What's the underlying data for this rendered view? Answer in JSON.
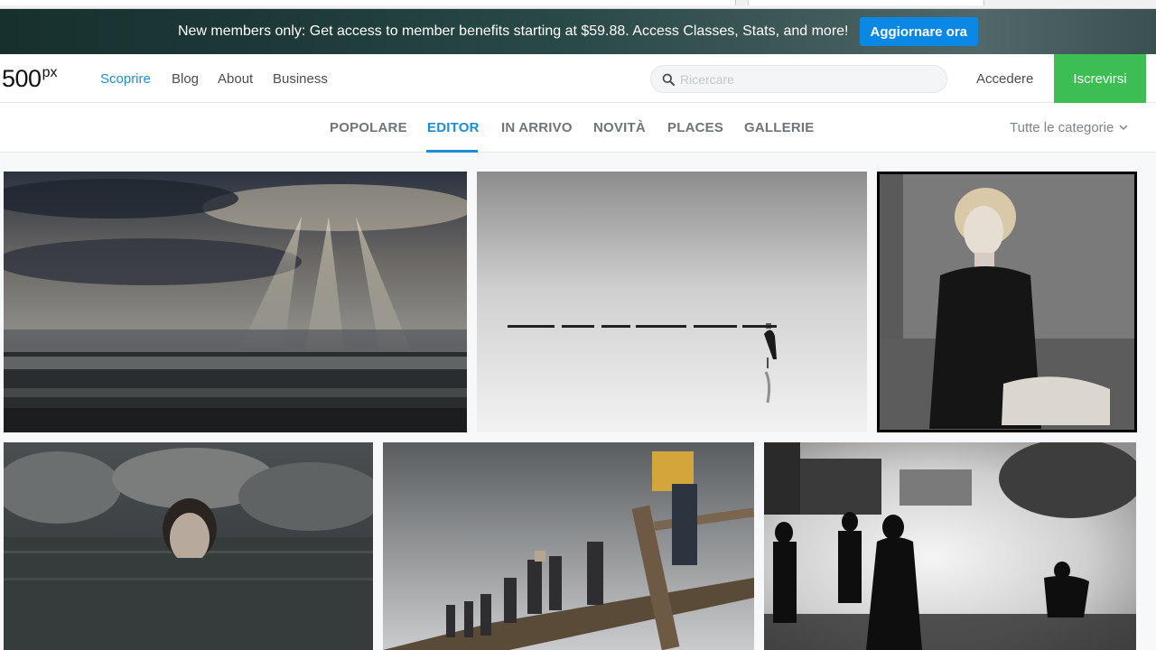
{
  "promo": {
    "text": "New members only: Get access to member benefits starting at $59.88. Access Classes, Stats, and more!",
    "button": "Aggiornare ora"
  },
  "nav": {
    "logo_main": "500",
    "logo_sup": "px",
    "links": [
      "Scoprire",
      "Blog",
      "About",
      "Business"
    ],
    "active_link": "Scoprire",
    "search_placeholder": "Ricercare",
    "login": "Accedere",
    "signup": "Iscrevirsi"
  },
  "tabs": {
    "items": [
      "POPOLARE",
      "EDITOR",
      "IN ARRIVO",
      "NOVITÀ",
      "PLACES",
      "GALLERIE"
    ],
    "active": "EDITOR",
    "categories": "Tutte le categorie"
  },
  "icons": {
    "search": "search-icon",
    "dropdown": "chevron-down-icon"
  },
  "colors": {
    "accent": "#1a8fd8",
    "signup": "#3dbe53",
    "promo_button": "#0b87e4"
  }
}
